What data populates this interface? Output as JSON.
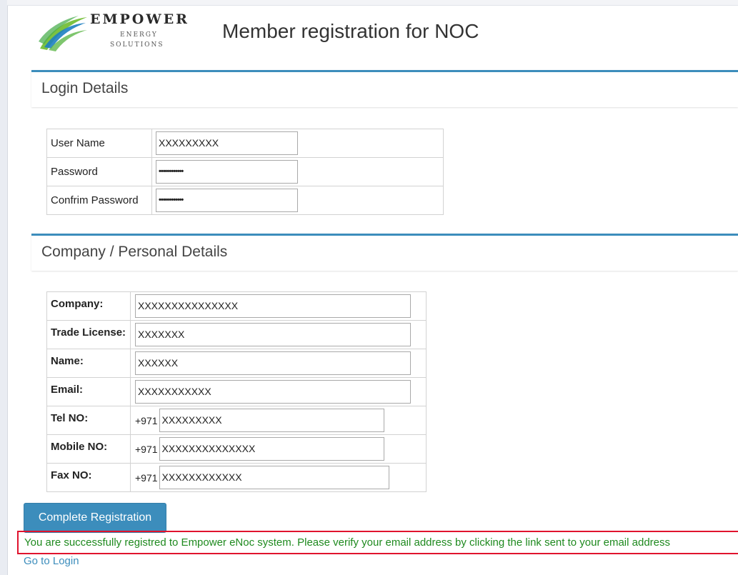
{
  "header": {
    "logo": {
      "brand": "EMPOWER",
      "line1": "ENERGY",
      "line2": "SOLUTIONS"
    },
    "title": "Member registration for NOC"
  },
  "login_section": {
    "title": "Login Details",
    "fields": [
      {
        "label": "User Name",
        "value": "XXXXXXXXX"
      },
      {
        "label": "Password",
        "value": "••••••••••••"
      },
      {
        "label": "Confrim Password",
        "value": "••••••••••••"
      }
    ]
  },
  "company_section": {
    "title": "Company / Personal Details",
    "fields": [
      {
        "label": "Company:",
        "value": "XXXXXXXXXXXXXXX"
      },
      {
        "label": "Trade License:",
        "value": "XXXXXXX"
      },
      {
        "label": "Name:",
        "value": "XXXXXX"
      },
      {
        "label": "Email:",
        "value": "XXXXXXXXXXX"
      },
      {
        "label": "Tel NO:",
        "prefix": "+971",
        "value": "XXXXXXXXX"
      },
      {
        "label": "Mobile NO:",
        "prefix": "+971",
        "value": "XXXXXXXXXXXXXX"
      },
      {
        "label": "Fax NO:",
        "prefix": "+971",
        "value": "XXXXXXXXXXXX"
      }
    ]
  },
  "actions": {
    "submit_label": "Complete Registration",
    "success_message": "You are successfully registred to Empower eNoc system. Please verify your email address by clicking the link sent to your email address",
    "login_link": "Go to Login"
  },
  "colors": {
    "accent": "#3c8dbc",
    "success_text": "#1f8a1f",
    "highlight_border": "#e0132e"
  }
}
